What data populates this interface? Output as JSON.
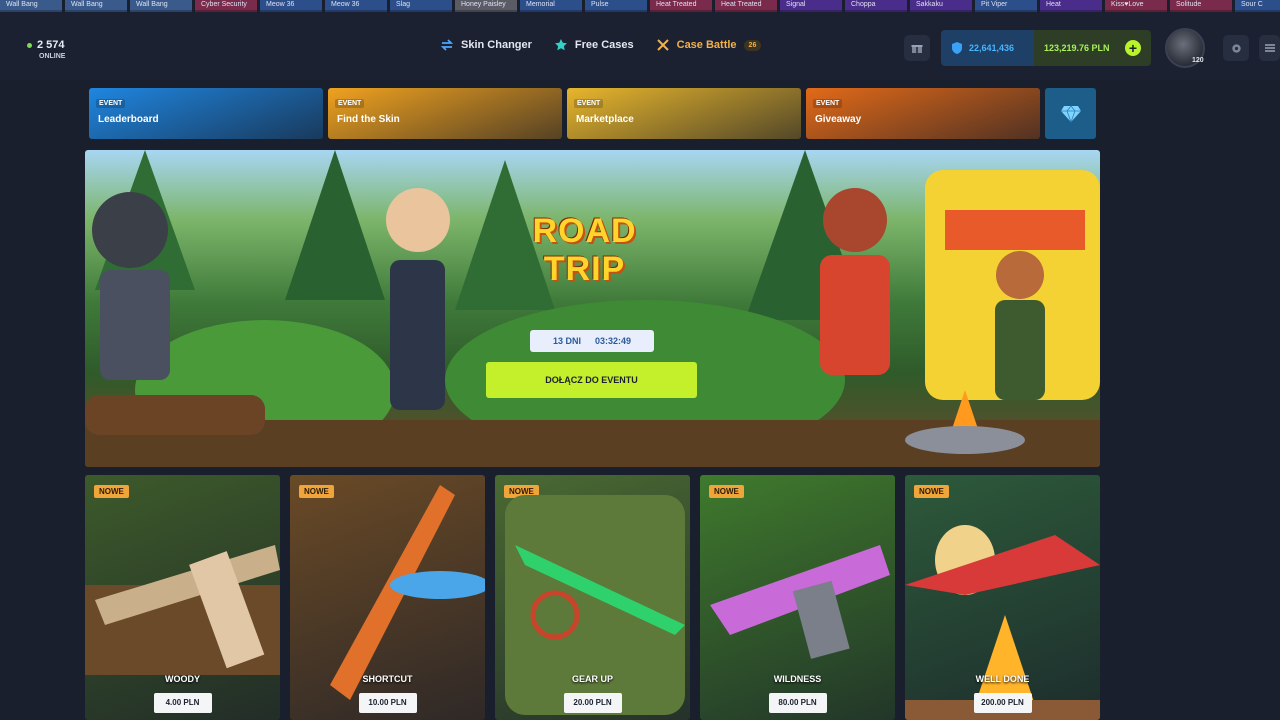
{
  "ticker": [
    {
      "label": "Wall Bang",
      "color": "#3a5a8c"
    },
    {
      "label": "Wall Bang",
      "color": "#3a5a8c"
    },
    {
      "label": "Wall Bang",
      "color": "#3a5a8c"
    },
    {
      "label": "Cyber Security",
      "color": "#7a2a4a"
    },
    {
      "label": "Meow 36",
      "color": "#2c4e8a"
    },
    {
      "label": "Meow 36",
      "color": "#2c4e8a"
    },
    {
      "label": "Slag",
      "color": "#2c4e8a"
    },
    {
      "label": "Honey Paisley",
      "color": "#5b5b66"
    },
    {
      "label": "Memorial",
      "color": "#2c4e8a"
    },
    {
      "label": "Pulse",
      "color": "#2c4e8a"
    },
    {
      "label": "Heat Treated",
      "color": "#7a2a4a"
    },
    {
      "label": "Heat Treated",
      "color": "#7a2a4a"
    },
    {
      "label": "Signal",
      "color": "#4a2c8a"
    },
    {
      "label": "Choppa",
      "color": "#4a2c8a"
    },
    {
      "label": "Sakkaku",
      "color": "#4a2c8a"
    },
    {
      "label": "Pit Viper",
      "color": "#2c4e8a"
    },
    {
      "label": "Heat",
      "color": "#4a2c8a"
    },
    {
      "label": "Kiss♥Love",
      "color": "#7a2a4a"
    },
    {
      "label": "Solitude",
      "color": "#7a2a4a"
    },
    {
      "label": "Sour C",
      "color": "#2c4e8a"
    }
  ],
  "online": {
    "count": "2 574",
    "label": "ONLINE"
  },
  "nav": [
    {
      "label": "Skin Changer",
      "icon": "swap-arrows-icon"
    },
    {
      "label": "Free Cases",
      "icon": "star-icon"
    },
    {
      "label": "Case Battle",
      "icon": "crossed-swords-icon",
      "badge": "26"
    }
  ],
  "balance": {
    "coins": "22,641,436",
    "cash": "123,219.76 PLN"
  },
  "avatar": {
    "level": "120"
  },
  "events": [
    {
      "tag": "EVENT",
      "title": "Leaderboard",
      "color": "#1f86e0"
    },
    {
      "tag": "EVENT",
      "title": "Find the Skin",
      "color": "#f0a21f"
    },
    {
      "tag": "EVENT",
      "title": "Marketplace",
      "color": "#e8b62c"
    },
    {
      "tag": "EVENT",
      "title": "Giveaway",
      "color": "#e26a18"
    }
  ],
  "hero": {
    "title_line1": "ROAD",
    "title_line2": "TRIP",
    "timer_days": "13 DNI",
    "timer_time": "03:32:49",
    "button": "DOŁĄCZ DO EVENTU"
  },
  "cases": [
    {
      "badge": "NOWE",
      "name": "WOODY",
      "price": "4.00 PLN",
      "color": "#3d5a2a"
    },
    {
      "badge": "NOWE",
      "name": "SHORTCUT",
      "price": "10.00 PLN",
      "color": "#6a4a26"
    },
    {
      "badge": "NOWE",
      "name": "GEAR UP",
      "price": "20.00 PLN",
      "color": "#4a6a32"
    },
    {
      "badge": "NOWE",
      "name": "WILDNESS",
      "price": "80.00 PLN",
      "color": "#3f7a2c"
    },
    {
      "badge": "NOWE",
      "name": "WELL DONE",
      "price": "200.00 PLN",
      "color": "#2d5a3a"
    }
  ]
}
